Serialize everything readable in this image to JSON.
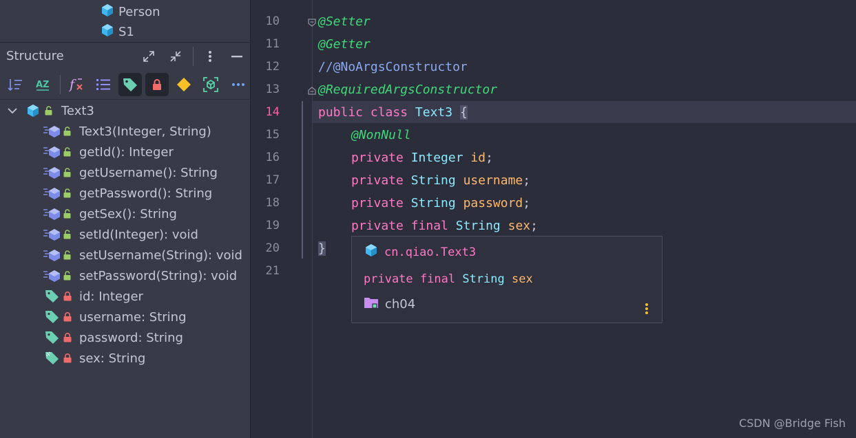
{
  "project_tree": {
    "items": [
      {
        "label": "Person"
      },
      {
        "label": "S1"
      }
    ]
  },
  "structure": {
    "title": "Structure",
    "toolbar": [
      {
        "name": "sort-by-visibility-icon",
        "active": false
      },
      {
        "name": "sort-alphabetically-icon",
        "active": false
      },
      {
        "name": "show-lambdas-icon",
        "active": false
      },
      {
        "name": "show-inherited-icon",
        "active": false
      },
      {
        "name": "show-fields-icon",
        "active": true
      },
      {
        "name": "show-non-public-icon",
        "active": true
      },
      {
        "name": "show-properties-icon",
        "active": false
      },
      {
        "name": "show-anonymous-classes-icon",
        "active": false
      },
      {
        "name": "more-icon",
        "active": false
      }
    ],
    "root": {
      "label": "Text3"
    },
    "members": [
      {
        "label": "Text3(Integer, String)",
        "kind": "method"
      },
      {
        "label": "getId(): Integer",
        "kind": "method"
      },
      {
        "label": "getUsername(): String",
        "kind": "method"
      },
      {
        "label": "getPassword(): String",
        "kind": "method"
      },
      {
        "label": "getSex(): String",
        "kind": "method"
      },
      {
        "label": "setId(Integer): void",
        "kind": "method"
      },
      {
        "label": "setUsername(String): void",
        "kind": "method"
      },
      {
        "label": "setPassword(String): void",
        "kind": "method"
      },
      {
        "label": "id: Integer",
        "kind": "field"
      },
      {
        "label": "username: String",
        "kind": "field"
      },
      {
        "label": "password: String",
        "kind": "field"
      },
      {
        "label": "sex: String",
        "kind": "final-field"
      }
    ]
  },
  "editor": {
    "lines": [
      {
        "num": "10",
        "text": "@Setter"
      },
      {
        "num": "11",
        "text": "@Getter"
      },
      {
        "num": "12",
        "text": "//@NoArgsConstructor"
      },
      {
        "num": "13",
        "text": "@RequiredArgsConstructor"
      },
      {
        "num": "14",
        "t1": "public",
        "t2": "class",
        "t3": "Text3",
        "t4": "{"
      },
      {
        "num": "15",
        "text": "@NonNull"
      },
      {
        "num": "16",
        "t1": "private",
        "t2": "Integer",
        "t3": "id",
        "t4": ";"
      },
      {
        "num": "17",
        "t1": "private",
        "t2": "String",
        "t3": "username",
        "t4": ";"
      },
      {
        "num": "18",
        "t1": "private",
        "t2": "String",
        "t3": "password",
        "t4": ";"
      },
      {
        "num": "19",
        "t1": "private",
        "t2": "final",
        "t3": "String",
        "t4": "sex",
        "t5": ";"
      },
      {
        "num": "20",
        "text": "}"
      },
      {
        "num": "21",
        "text": ""
      }
    ],
    "current_line": "14"
  },
  "quick_doc": {
    "class_name": "cn.qiao.Text3",
    "decl_kw1": "private",
    "decl_kw2": "final",
    "decl_type": "String",
    "decl_name": "sex",
    "module": "ch04"
  },
  "watermark": "CSDN @Bridge Fish",
  "colors": {
    "background": "#2b2d3a",
    "panel": "#383a47",
    "annotation": "#3ed879",
    "keyword": "#ff79c6",
    "type": "#8be9fd",
    "field": "#ffb86c",
    "current_line_number": "#ff5fa3"
  }
}
